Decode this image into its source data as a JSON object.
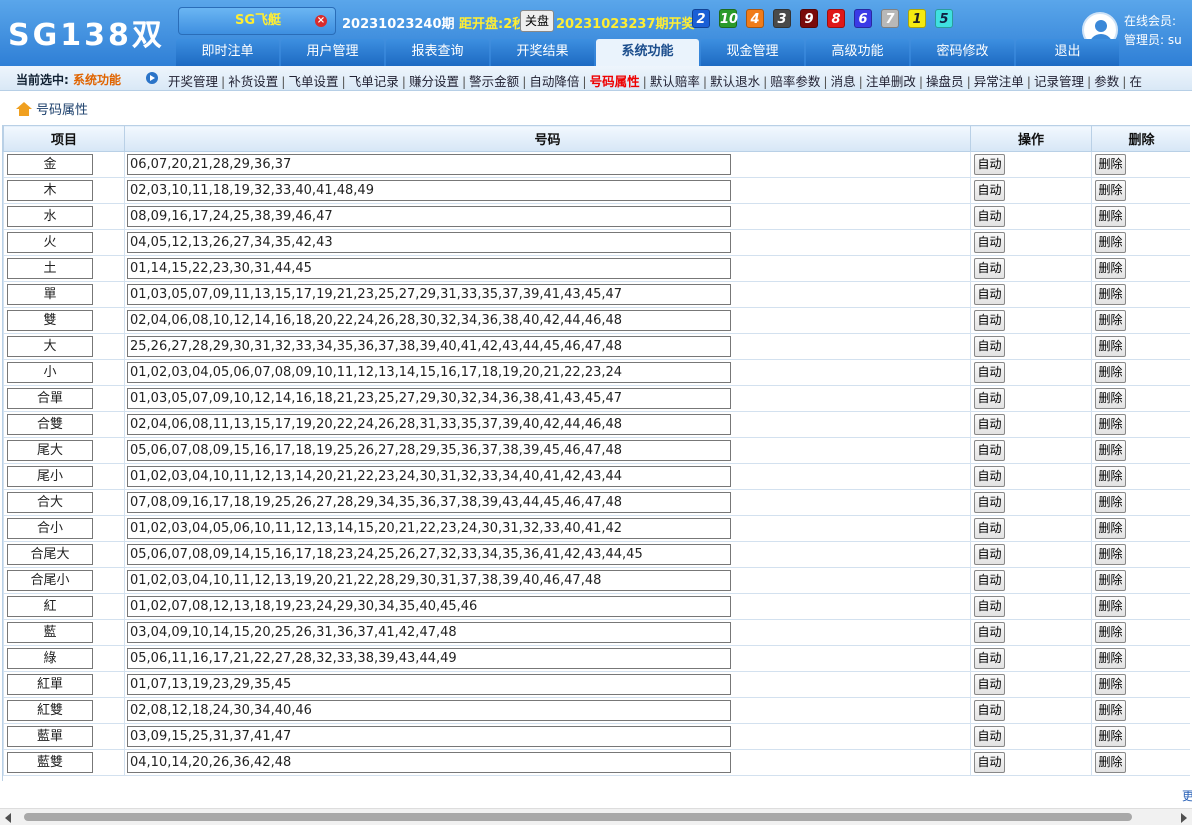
{
  "header": {
    "logo": "SG138双",
    "game": "SG飞艇",
    "period": "20231023240期",
    "countdown_label": "距开盘:2秒",
    "close_button": "关盘",
    "last_period": "20231023237期开奖:",
    "balls": [
      {
        "n": "2",
        "color": "#1a5fd6",
        "text": "#fff"
      },
      {
        "n": "10",
        "color": "#2a9a2a",
        "text": "#fff"
      },
      {
        "n": "4",
        "color": "#f07c1a",
        "text": "#fff"
      },
      {
        "n": "3",
        "color": "#4a4a4a",
        "text": "#fff"
      },
      {
        "n": "9",
        "color": "#7a0a0a",
        "text": "#fff"
      },
      {
        "n": "8",
        "color": "#e01818",
        "text": "#fff"
      },
      {
        "n": "6",
        "color": "#3a3ae6",
        "text": "#fff"
      },
      {
        "n": "7",
        "color": "#b8b8b8",
        "text": "#fff"
      },
      {
        "n": "1",
        "color": "#f5ea10",
        "text": "#222"
      },
      {
        "n": "5",
        "color": "#40e0e0",
        "text": "#124"
      }
    ],
    "online_label": "在线会员:",
    "admin_label": "管理员: su"
  },
  "nav": [
    "即时注单",
    "用户管理",
    "报表查询",
    "开奖结果",
    "系统功能",
    "现金管理",
    "高级功能",
    "密码修改",
    "退出"
  ],
  "nav_active": 4,
  "subbar": {
    "current_label": "当前选中:",
    "current_value": "系统功能",
    "links": [
      "开奖管理",
      "补货设置",
      "飞单设置",
      "飞单记录",
      "赚分设置",
      "警示金额",
      "自动降倍",
      "号码属性",
      "默认赔率",
      "默认退水",
      "赔率参数",
      "消息",
      "注单删改",
      "操盘员",
      "异常注单",
      "记录管理",
      "参数",
      "在"
    ],
    "active_link": 7
  },
  "breadcrumb": "号码属性",
  "table": {
    "headers": [
      "项目",
      "号码",
      "操作",
      "删除"
    ],
    "auto_label": "自动",
    "delete_label": "删除",
    "rows": [
      {
        "name": "金",
        "nums": "06,07,20,21,28,29,36,37"
      },
      {
        "name": "木",
        "nums": "02,03,10,11,18,19,32,33,40,41,48,49"
      },
      {
        "name": "水",
        "nums": "08,09,16,17,24,25,38,39,46,47"
      },
      {
        "name": "火",
        "nums": "04,05,12,13,26,27,34,35,42,43"
      },
      {
        "name": "土",
        "nums": "01,14,15,22,23,30,31,44,45"
      },
      {
        "name": "單",
        "nums": "01,03,05,07,09,11,13,15,17,19,21,23,25,27,29,31,33,35,37,39,41,43,45,47"
      },
      {
        "name": "雙",
        "nums": "02,04,06,08,10,12,14,16,18,20,22,24,26,28,30,32,34,36,38,40,42,44,46,48"
      },
      {
        "name": "大",
        "nums": "25,26,27,28,29,30,31,32,33,34,35,36,37,38,39,40,41,42,43,44,45,46,47,48"
      },
      {
        "name": "小",
        "nums": "01,02,03,04,05,06,07,08,09,10,11,12,13,14,15,16,17,18,19,20,21,22,23,24"
      },
      {
        "name": "合單",
        "nums": "01,03,05,07,09,10,12,14,16,18,21,23,25,27,29,30,32,34,36,38,41,43,45,47"
      },
      {
        "name": "合雙",
        "nums": "02,04,06,08,11,13,15,17,19,20,22,24,26,28,31,33,35,37,39,40,42,44,46,48"
      },
      {
        "name": "尾大",
        "nums": "05,06,07,08,09,15,16,17,18,19,25,26,27,28,29,35,36,37,38,39,45,46,47,48"
      },
      {
        "name": "尾小",
        "nums": "01,02,03,04,10,11,12,13,14,20,21,22,23,24,30,31,32,33,34,40,41,42,43,44"
      },
      {
        "name": "合大",
        "nums": "07,08,09,16,17,18,19,25,26,27,28,29,34,35,36,37,38,39,43,44,45,46,47,48"
      },
      {
        "name": "合小",
        "nums": "01,02,03,04,05,06,10,11,12,13,14,15,20,21,22,23,24,30,31,32,33,40,41,42"
      },
      {
        "name": "合尾大",
        "nums": "05,06,07,08,09,14,15,16,17,18,23,24,25,26,27,32,33,34,35,36,41,42,43,44,45"
      },
      {
        "name": "合尾小",
        "nums": "01,02,03,04,10,11,12,13,19,20,21,22,28,29,30,31,37,38,39,40,46,47,48"
      },
      {
        "name": "紅",
        "nums": "01,02,07,08,12,13,18,19,23,24,29,30,34,35,40,45,46"
      },
      {
        "name": "藍",
        "nums": "03,04,09,10,14,15,20,25,26,31,36,37,41,42,47,48"
      },
      {
        "name": "綠",
        "nums": "05,06,11,16,17,21,22,27,28,32,33,38,39,43,44,49"
      },
      {
        "name": "紅單",
        "nums": "01,07,13,19,23,29,35,45"
      },
      {
        "name": "紅雙",
        "nums": "02,08,12,18,24,30,34,40,46"
      },
      {
        "name": "藍單",
        "nums": "03,09,15,25,31,37,41,47"
      },
      {
        "name": "藍雙",
        "nums": "04,10,14,20,26,36,42,48"
      }
    ]
  },
  "more_link": "更"
}
